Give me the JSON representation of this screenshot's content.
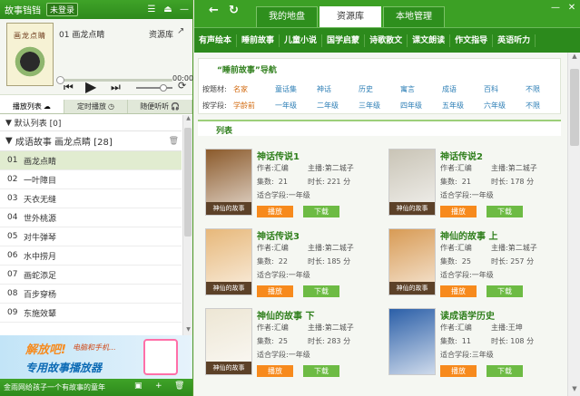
{
  "app": {
    "title": "故事铛铛",
    "login_badge": "未登录"
  },
  "player": {
    "cover_text": "画龙点睛",
    "now_playing": "01 画龙点睛",
    "source_link": "资源库",
    "time": "00:00",
    "progress": 0
  },
  "left_tabs": [
    {
      "label": "播放列表",
      "icon": "cloud-icon"
    },
    {
      "label": "定时播放",
      "icon": "clock-icon"
    },
    {
      "label": "随便听听",
      "icon": "headphones-icon"
    }
  ],
  "playlists": {
    "default": "默认列表 [0]",
    "current": "成语故事 画龙点睛 [28]"
  },
  "tracks": [
    {
      "num": "01",
      "name": "画龙点睛"
    },
    {
      "num": "02",
      "name": "一叶障目"
    },
    {
      "num": "03",
      "name": "天衣无缝"
    },
    {
      "num": "04",
      "name": "世外桃源"
    },
    {
      "num": "05",
      "name": "对牛弹琴"
    },
    {
      "num": "06",
      "name": "水中捞月"
    },
    {
      "num": "07",
      "name": "画蛇添足"
    },
    {
      "num": "08",
      "name": "百步穿杨"
    },
    {
      "num": "09",
      "name": "东施效颦"
    }
  ],
  "banner": {
    "line1": "解放吧!",
    "line2": "电脑和手机...",
    "line3": "专用故事播放器"
  },
  "footer": {
    "text": "金雨网给孩子一个有故事的童年"
  },
  "tabs": [
    "我的地盘",
    "资源库",
    "本地管理"
  ],
  "categories": [
    "有声绘本",
    "睡前故事",
    "儿童小说",
    "国学启蒙",
    "诗歌散文",
    "课文朗读",
    "作文指导",
    "英语听力"
  ],
  "nav": {
    "title": "“睡前故事”导航",
    "rows": [
      {
        "label": "按题材:",
        "values": [
          "名家",
          "童话集",
          "神话",
          "历史",
          "寓言",
          "成语",
          "百科",
          "不限"
        ]
      },
      {
        "label": "按学段:",
        "values": [
          "学龄前",
          "一年级",
          "二年级",
          "三年级",
          "四年级",
          "五年级",
          "六年级",
          "不限"
        ]
      }
    ]
  },
  "list_title": "列表",
  "labels": {
    "author": "作者:",
    "host": "主播:",
    "episodes": "集数:",
    "duration": "时长:",
    "grade": "适合学段:",
    "play": "播放",
    "download": "下载"
  },
  "books": [
    {
      "title": "神话传说1",
      "author": "汇编",
      "host": "第二城子",
      "episodes": "21",
      "duration": "221 分",
      "grade": "一年级",
      "tag": "神仙的故事",
      "color": "#8b5a2b"
    },
    {
      "title": "神话传说2",
      "author": "汇编",
      "host": "第二城子",
      "episodes": "21",
      "duration": "178 分",
      "grade": "一年级",
      "tag": "神仙的故事",
      "color": "#c9c4b6"
    },
    {
      "title": "神话传说3",
      "author": "汇编",
      "host": "第二城子",
      "episodes": "22",
      "duration": "185 分",
      "grade": "一年级",
      "tag": "神仙的故事",
      "color": "#e7b87a"
    },
    {
      "title": "神仙的故事 上",
      "author": "汇编",
      "host": "第二城子",
      "episodes": "25",
      "duration": "257 分",
      "grade": "一年级",
      "tag": "神仙的故事",
      "color": "#d89b55"
    },
    {
      "title": "神仙的故事 下",
      "author": "汇编",
      "host": "第二城子",
      "episodes": "25",
      "duration": "283 分",
      "grade": "一年级",
      "tag": "神仙的故事",
      "color": "#ede6d4"
    },
    {
      "title": "读成语学历史",
      "author": "汇编",
      "host": "王坤",
      "episodes": "11",
      "duration": "108 分",
      "grade": "三年级",
      "tag": "",
      "color": "#2b5fa8"
    }
  ],
  "colors": {
    "brand_green": "#3ca025",
    "play": "#f78a1d",
    "download": "#6dbb44"
  }
}
